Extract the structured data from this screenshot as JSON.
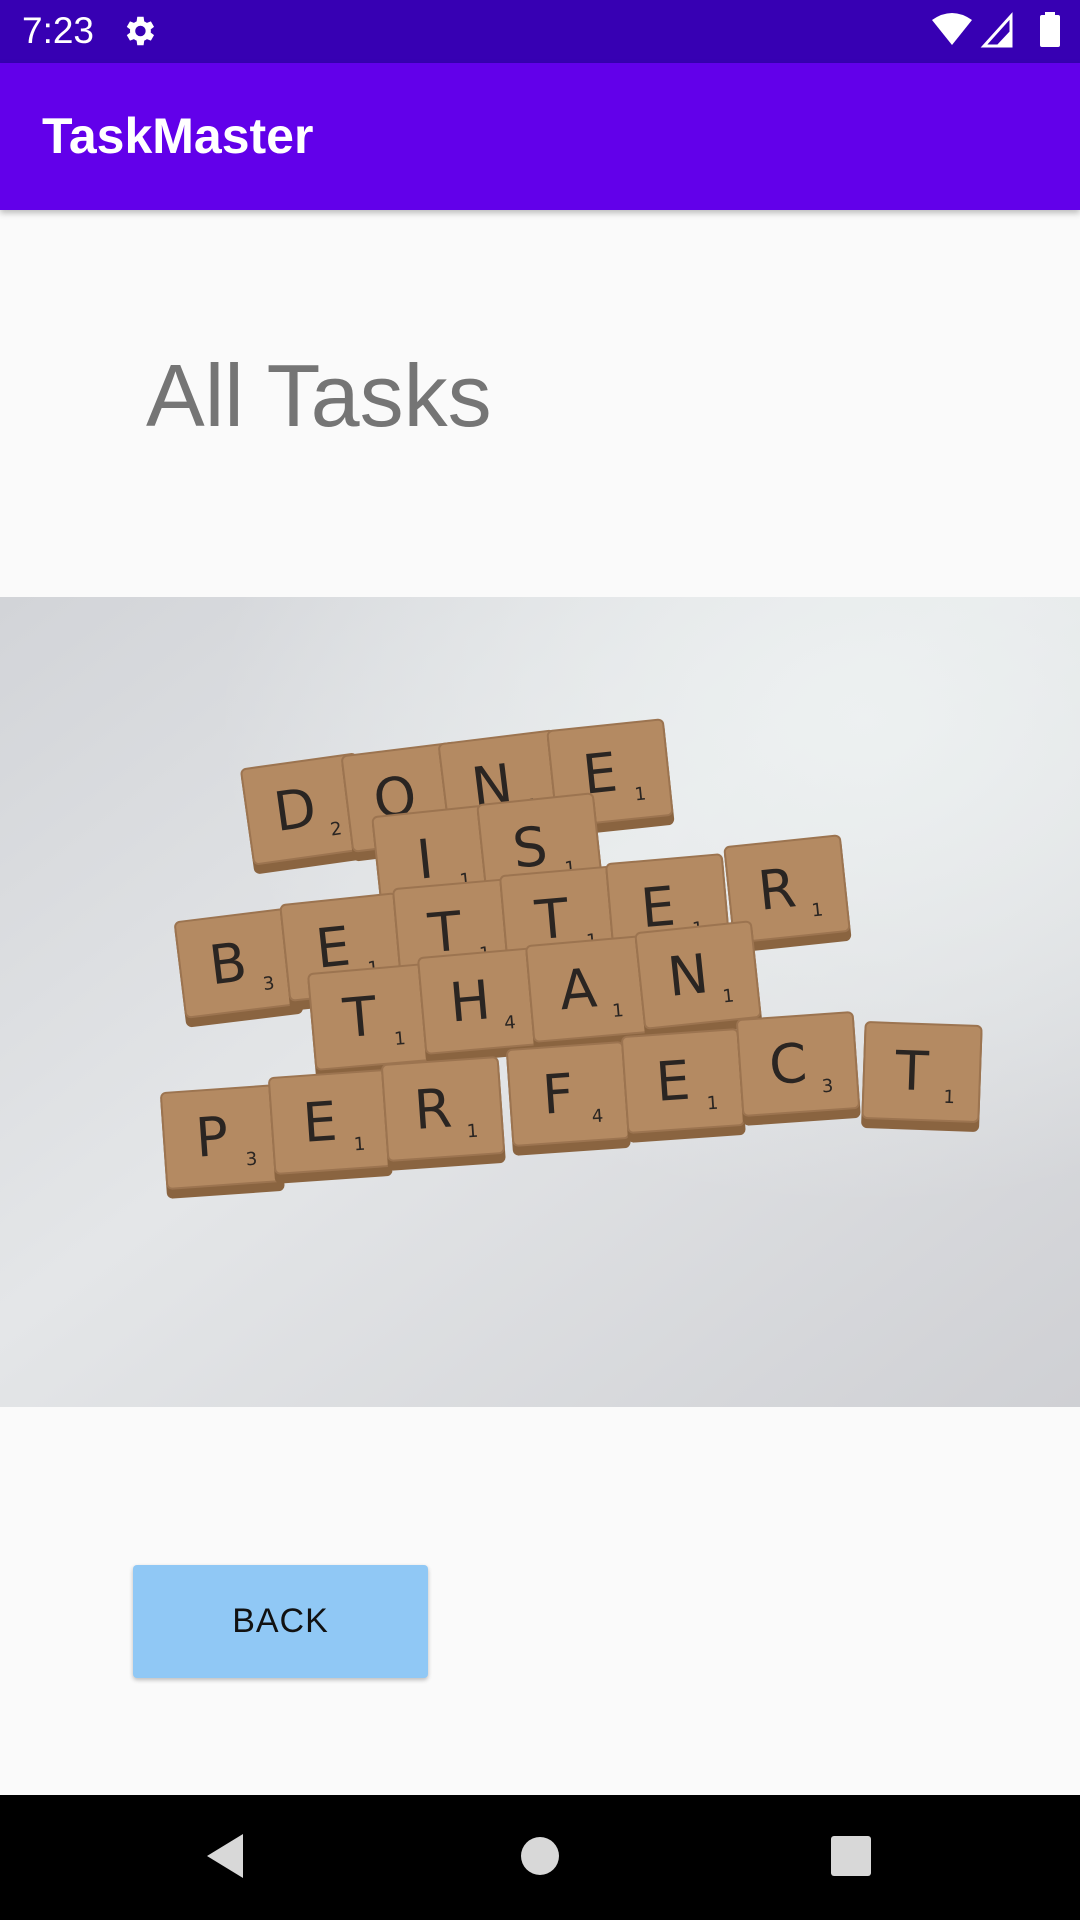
{
  "status_bar": {
    "time": "7:23",
    "icons": [
      "settings-icon",
      "wifi-icon",
      "signal-icon",
      "battery-icon"
    ]
  },
  "app_bar": {
    "title": "TaskMaster",
    "color": "#6200ea"
  },
  "main": {
    "title": "All Tasks",
    "image": {
      "tiles": [
        {
          "letter": "D",
          "score": "2"
        },
        {
          "letter": "O",
          "score": "1"
        },
        {
          "letter": "N",
          "score": "1"
        },
        {
          "letter": "E",
          "score": "1"
        },
        {
          "letter": "I",
          "score": "1"
        },
        {
          "letter": "S",
          "score": "1"
        },
        {
          "letter": "B",
          "score": "3"
        },
        {
          "letter": "E",
          "score": "1"
        },
        {
          "letter": "T",
          "score": "1"
        },
        {
          "letter": "T",
          "score": "1"
        },
        {
          "letter": "E",
          "score": "1"
        },
        {
          "letter": "R",
          "score": "1"
        },
        {
          "letter": "T",
          "score": "1"
        },
        {
          "letter": "H",
          "score": "4"
        },
        {
          "letter": "A",
          "score": "1"
        },
        {
          "letter": "N",
          "score": "1"
        },
        {
          "letter": "P",
          "score": "3"
        },
        {
          "letter": "E",
          "score": "1"
        },
        {
          "letter": "R",
          "score": "1"
        },
        {
          "letter": "F",
          "score": "4"
        },
        {
          "letter": "E",
          "score": "1"
        },
        {
          "letter": "C",
          "score": "3"
        },
        {
          "letter": "T",
          "score": "1"
        }
      ]
    },
    "back_label": "BACK",
    "back_color": "#90c8f5"
  },
  "nav_bar": {
    "icons": [
      "back-triangle-icon",
      "home-circle-icon",
      "recents-square-icon"
    ]
  }
}
